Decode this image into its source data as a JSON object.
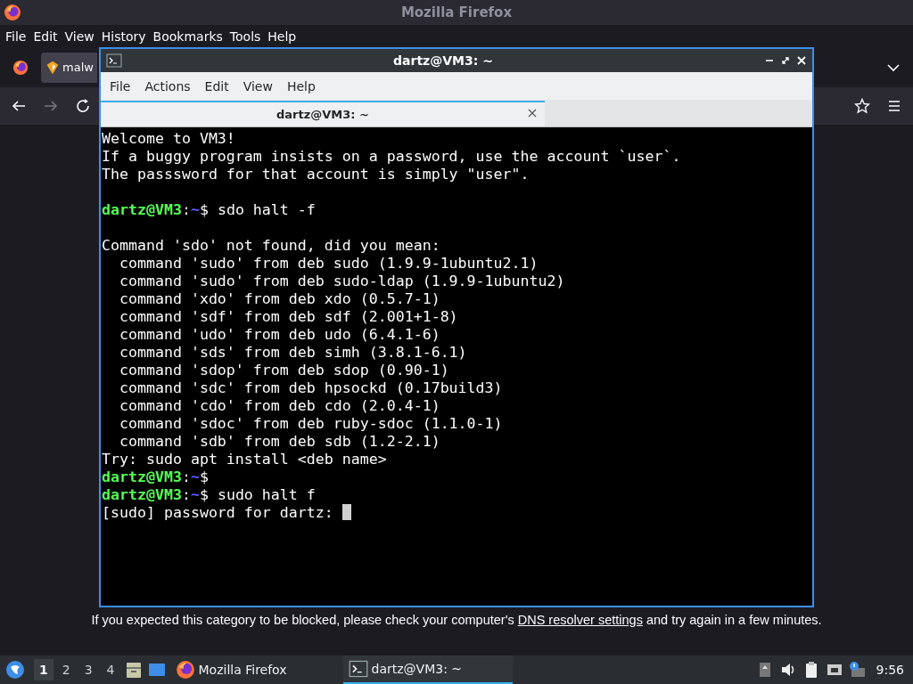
{
  "firefox": {
    "title": "Mozilla Firefox",
    "menu": [
      "File",
      "Edit",
      "View",
      "History",
      "Bookmarks",
      "Tools",
      "Help"
    ],
    "tab": {
      "label": "malw"
    },
    "page_message": {
      "before": "If you expected this category to be blocked, please check your computer's ",
      "link": "DNS resolver settings",
      "after": " and try again in a few minutes."
    }
  },
  "terminal": {
    "title": "dartz@VM3: ~",
    "menu": [
      "File",
      "Actions",
      "Edit",
      "View",
      "Help"
    ],
    "tabs": [
      {
        "label": "dartz@VM3: ~",
        "selected": true
      }
    ],
    "lines": [
      {
        "kind": "text",
        "text": "Welcome to VM3!"
      },
      {
        "kind": "text",
        "text": "If a buggy program insists on a password, use the account `user`."
      },
      {
        "kind": "text",
        "text": "The passsword for that account is simply \"user\"."
      },
      {
        "kind": "blank"
      },
      {
        "kind": "prompt",
        "user_host": "dartz@VM3",
        "separator": ":",
        "path": "~",
        "symbol": "$",
        "command": "sdo halt -f"
      },
      {
        "kind": "blank"
      },
      {
        "kind": "text",
        "text": "Command 'sdo' not found, did you mean:"
      },
      {
        "kind": "text",
        "text": "  command 'sudo' from deb sudo (1.9.9-1ubuntu2.1)"
      },
      {
        "kind": "text",
        "text": "  command 'sudo' from deb sudo-ldap (1.9.9-1ubuntu2)"
      },
      {
        "kind": "text",
        "text": "  command 'xdo' from deb xdo (0.5.7-1)"
      },
      {
        "kind": "text",
        "text": "  command 'sdf' from deb sdf (2.001+1-8)"
      },
      {
        "kind": "text",
        "text": "  command 'udo' from deb udo (6.4.1-6)"
      },
      {
        "kind": "text",
        "text": "  command 'sds' from deb simh (3.8.1-6.1)"
      },
      {
        "kind": "text",
        "text": "  command 'sdop' from deb sdop (0.90-1)"
      },
      {
        "kind": "text",
        "text": "  command 'sdc' from deb hpsockd (0.17build3)"
      },
      {
        "kind": "text",
        "text": "  command 'cdo' from deb cdo (2.0.4-1)"
      },
      {
        "kind": "text",
        "text": "  command 'sdoc' from deb ruby-sdoc (1.1.0-1)"
      },
      {
        "kind": "text",
        "text": "  command 'sdb' from deb sdb (1.2-2.1)"
      },
      {
        "kind": "text",
        "text": "Try: sudo apt install <deb name>"
      },
      {
        "kind": "prompt",
        "user_host": "dartz@VM3",
        "separator": ":",
        "path": "~",
        "symbol": "$"
      },
      {
        "kind": "prompt",
        "user_host": "dartz@VM3",
        "separator": ":",
        "path": "~",
        "symbol": "$",
        "command": "sudo halt f"
      },
      {
        "kind": "text",
        "text": "[sudo] password for dartz: ",
        "cursor": true
      }
    ]
  },
  "taskbar": {
    "desktops": [
      {
        "label": "1",
        "selected": true
      },
      {
        "label": "2",
        "selected": false
      },
      {
        "label": "3",
        "selected": false
      },
      {
        "label": "4",
        "selected": false
      }
    ],
    "tasks": [
      {
        "label": "Mozilla Firefox",
        "selected": false
      },
      {
        "label": "dartz@VM3: ~",
        "selected": true
      }
    ],
    "clock": "9:56"
  }
}
